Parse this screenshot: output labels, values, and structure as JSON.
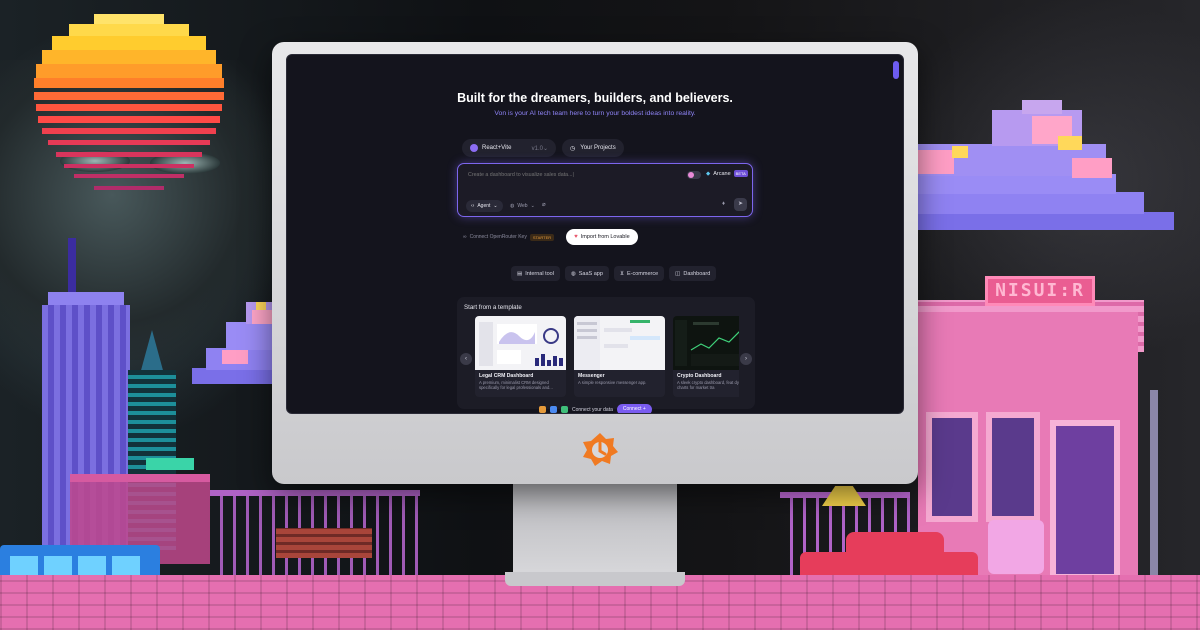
{
  "hero": {
    "title": "Built for the dreamers, builders, and believers.",
    "subtitle": "Von is your AI tech team here to turn your boldest ideas into reality."
  },
  "top_row": {
    "framework": "React+Vite",
    "version": "v1.0",
    "projects": "Your Projects"
  },
  "prompt": {
    "placeholder": "Create a dashboard to visualize sales data...|",
    "mode": "Arcane",
    "beta": "BETA",
    "agent": "Agent",
    "web": "Web"
  },
  "actions": {
    "connect_openrouter": "Connect OpenRouter Key",
    "starter": "STARTER",
    "import_lovable": "Import from Lovable"
  },
  "chips": [
    "Internal tool",
    "SaaS app",
    "E-commerce",
    "Dashboard"
  ],
  "templates": {
    "title": "Start from a template",
    "cards": [
      {
        "title": "Legal CRM Dashboard",
        "desc": "A premium, minimalist CRM designed specifically for legal professionals and..."
      },
      {
        "title": "Messenger",
        "desc": "A simple responsive messenger app."
      },
      {
        "title": "Crypto Dashboard",
        "desc": "A sleek crypto dashboard, feat dynamic charts for market tra"
      }
    ]
  },
  "connect_data": {
    "label": "Connect your data",
    "button": "Connect"
  },
  "scene": {
    "store_sign": "NISUI:R"
  },
  "colors": {
    "accent": "#7d66ee",
    "screen_bg": "#14141d",
    "subtitle": "#8f84f7"
  }
}
